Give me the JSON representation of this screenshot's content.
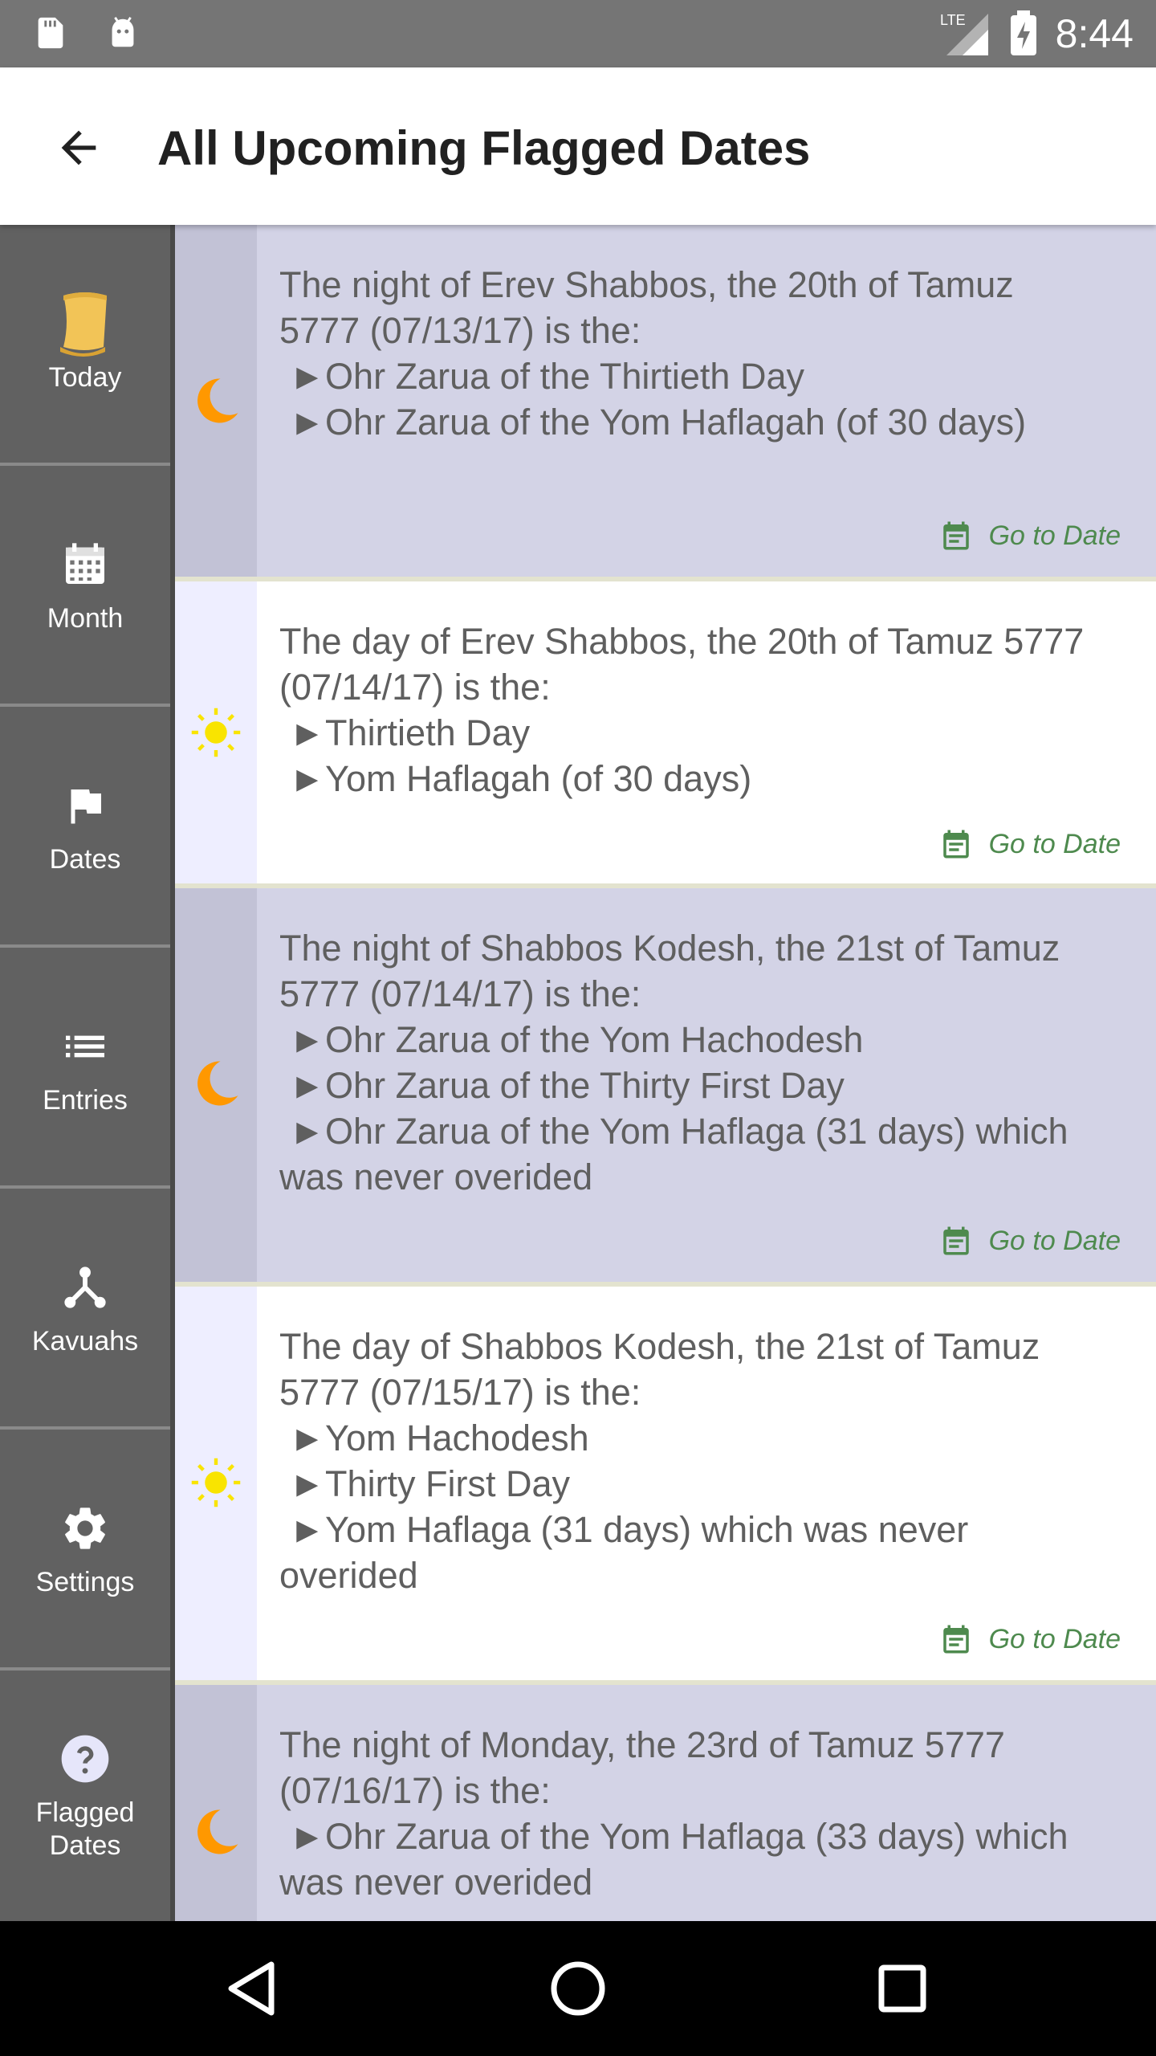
{
  "status_bar": {
    "time": "8:44",
    "network": "LTE",
    "icons": [
      "sd-card-icon",
      "android-debug-icon",
      "signal-icon",
      "battery-charging-icon"
    ]
  },
  "app_bar": {
    "title": "All Upcoming Flagged Dates",
    "back_icon": "arrow-back-icon"
  },
  "sidebar": {
    "items": [
      {
        "label": "Today",
        "icon": "scroll-icon"
      },
      {
        "label": "Month",
        "icon": "calendar-grid-icon"
      },
      {
        "label": "Dates",
        "icon": "flag-icon"
      },
      {
        "label": "Entries",
        "icon": "list-icon"
      },
      {
        "label": "Kavuahs",
        "icon": "fork-icon"
      },
      {
        "label": "Settings",
        "icon": "gear-icon"
      },
      {
        "label": "Flagged\nDates",
        "icon": "help-circle-icon"
      }
    ]
  },
  "entries": [
    {
      "time_of_day": "night",
      "text": "The night of Erev Shabbos, the 20th of Tamuz 5777 (07/13/17) is the:\n ►Ohr Zarua of the Thirtieth Day\n ►Ohr Zarua of the Yom Haflagah (of 30 days)",
      "action": "Go to Date"
    },
    {
      "time_of_day": "day",
      "text": "The day of Erev Shabbos, the 20th of Tamuz 5777 (07/14/17) is the:\n ►Thirtieth Day\n ►Yom Haflagah (of 30 days)",
      "action": "Go to Date"
    },
    {
      "time_of_day": "night",
      "text": "The night of Shabbos Kodesh, the 21st of Tamuz 5777 (07/14/17) is the:\n ►Ohr Zarua of the Yom Hachodesh\n ►Ohr Zarua of the Thirty First Day\n ►Ohr Zarua of the Yom Haflaga (31 days) which was never overided",
      "action": "Go to Date"
    },
    {
      "time_of_day": "day",
      "text": "The day of Shabbos Kodesh, the 21st of Tamuz 5777 (07/15/17) is the:\n ►Yom Hachodesh\n ►Thirty First Day\n ►Yom Haflaga (31 days) which was never overided",
      "action": "Go to Date"
    },
    {
      "time_of_day": "night",
      "text": "The night of Monday, the 23rd of Tamuz 5777 (07/16/17) is the:\n ►Ohr Zarua of the Yom Haflaga (33 days) which was never overided",
      "action": ""
    }
  ],
  "colors": {
    "status_bar": "#757575",
    "sidebar": "#616161",
    "night_row": "#d3d3e6",
    "day_row": "#ffffff",
    "moon": "#ff9800",
    "sun": "#f9e400",
    "go_to_date": "#4e8a4e"
  },
  "nav_bar": {
    "icons": [
      "back-triangle-icon",
      "home-circle-icon",
      "recents-square-icon"
    ]
  }
}
